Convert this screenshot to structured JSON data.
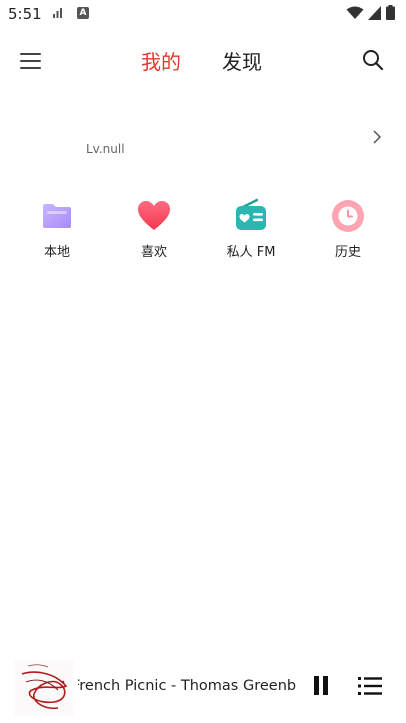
{
  "status_bar": {
    "time": "5:51",
    "icons": [
      "sim-card-icon",
      "a-notification-icon",
      "wifi-icon",
      "signal-icon",
      "battery-icon"
    ]
  },
  "nav": {
    "menu_icon": "hamburger-menu-icon",
    "tabs": [
      {
        "label": "我的",
        "active": true
      },
      {
        "label": "发现",
        "active": false
      }
    ],
    "search_icon": "search-icon",
    "active_color": "#e03a2e"
  },
  "profile": {
    "level": "Lv.null",
    "chevron_icon": "chevron-right-icon"
  },
  "quick_actions": [
    {
      "label": "本地",
      "icon": "folder-icon",
      "color": "#b9a3ff"
    },
    {
      "label": "喜欢",
      "icon": "heart-icon",
      "color": "#ff4d6d"
    },
    {
      "label": "私人 FM",
      "icon": "radio-icon",
      "color": "#2bb6b0"
    },
    {
      "label": "历史",
      "icon": "clock-icon",
      "color": "#ff8fa3"
    }
  ],
  "player": {
    "album_art_icon": "album-art",
    "song_title": "French Picnic - Thomas Greenberg",
    "pause_icon": "pause-icon",
    "playlist_icon": "playlist-icon"
  }
}
